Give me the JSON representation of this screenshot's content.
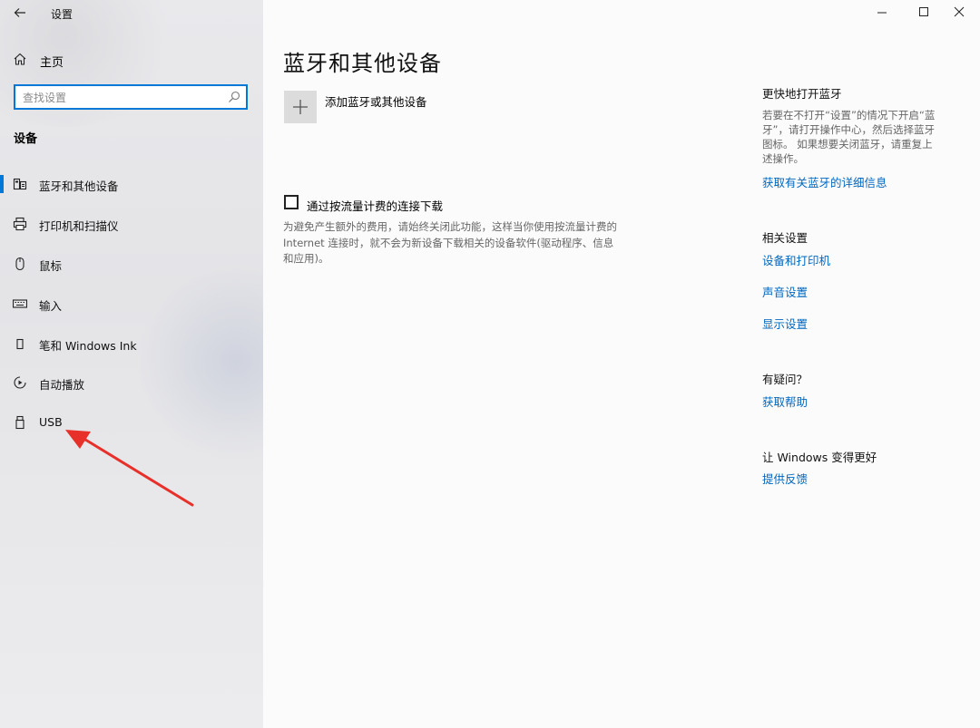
{
  "window": {
    "app_title": "设置",
    "back_icon": "back-arrow-icon",
    "controls": [
      "minimize-icon",
      "maximize-icon",
      "close-icon"
    ]
  },
  "sidebar": {
    "home_label": "主页",
    "search_placeholder": "查找设置",
    "section_title": "设备",
    "items": [
      {
        "label": "蓝牙和其他设备",
        "icon": "bluetooth-devices-icon",
        "selected": true
      },
      {
        "label": "打印机和扫描仪",
        "icon": "printer-icon",
        "selected": false
      },
      {
        "label": "鼠标",
        "icon": "mouse-icon",
        "selected": false
      },
      {
        "label": "输入",
        "icon": "keyboard-icon",
        "selected": false
      },
      {
        "label": "笔和 Windows Ink",
        "icon": "pen-icon",
        "selected": false
      },
      {
        "label": "自动播放",
        "icon": "autoplay-icon",
        "selected": false
      },
      {
        "label": "USB",
        "icon": "usb-icon",
        "selected": false
      }
    ]
  },
  "main": {
    "page_title": "蓝牙和其他设备",
    "add_device_label": "添加蓝牙或其他设备",
    "metered_checkbox": {
      "label": "通过按流量计费的连接下载",
      "checked": false,
      "description_line1": "为避免产生额外的费用，请始终关闭此功能，这样当你使用按流量计费的",
      "description_line2": "Internet 连接时，就不会为新设备下载相关的设备软件(驱动程序、信息",
      "description_line3": "和应用)。"
    }
  },
  "side_panel": {
    "quick_title": "更快地打开蓝牙",
    "quick_text_line1": "若要在不打开“设置”的情况下开启“蓝",
    "quick_text_line2": "牙”，请打开操作中心，然后选择蓝牙",
    "quick_text_line3": "图标。 如果想要关闭蓝牙，请重复上",
    "quick_text_line4": "述操作。",
    "quick_link": "获取有关蓝牙的详细信息",
    "related_title": "相关设置",
    "related_links": [
      "设备和打印机",
      "声音设置",
      "显示设置"
    ],
    "help_title": "有疑问？",
    "help_link": "获取帮助",
    "feedback_title": "让 Windows 变得更好",
    "feedback_link": "提供反馈"
  },
  "colors": {
    "accent": "#0078d7",
    "link": "#0067c0",
    "annotation_arrow": "#e8302a"
  }
}
